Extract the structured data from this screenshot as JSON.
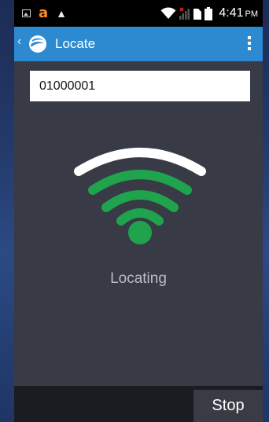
{
  "status_bar": {
    "time": "4:41",
    "ampm": "PM",
    "icons": [
      "image-icon",
      "amazon-icon",
      "warning-icon",
      "wifi-icon",
      "signal-icon",
      "sim-icon",
      "battery-icon"
    ]
  },
  "app_bar": {
    "title": "Locate",
    "icons": [
      "back-chevron-icon",
      "app-logo-icon",
      "overflow-menu-icon"
    ]
  },
  "tag_field": {
    "value": "01000001"
  },
  "locator": {
    "status": "Locating",
    "colors": {
      "arc_top": "#ffffff",
      "signal": "#1fa34d"
    }
  },
  "bottom_bar": {
    "stop_label": "Stop"
  },
  "colors": {
    "app_bar": "#2d8ad0",
    "content_background": "#383a46",
    "bottom_bar": "#1b1c21"
  }
}
